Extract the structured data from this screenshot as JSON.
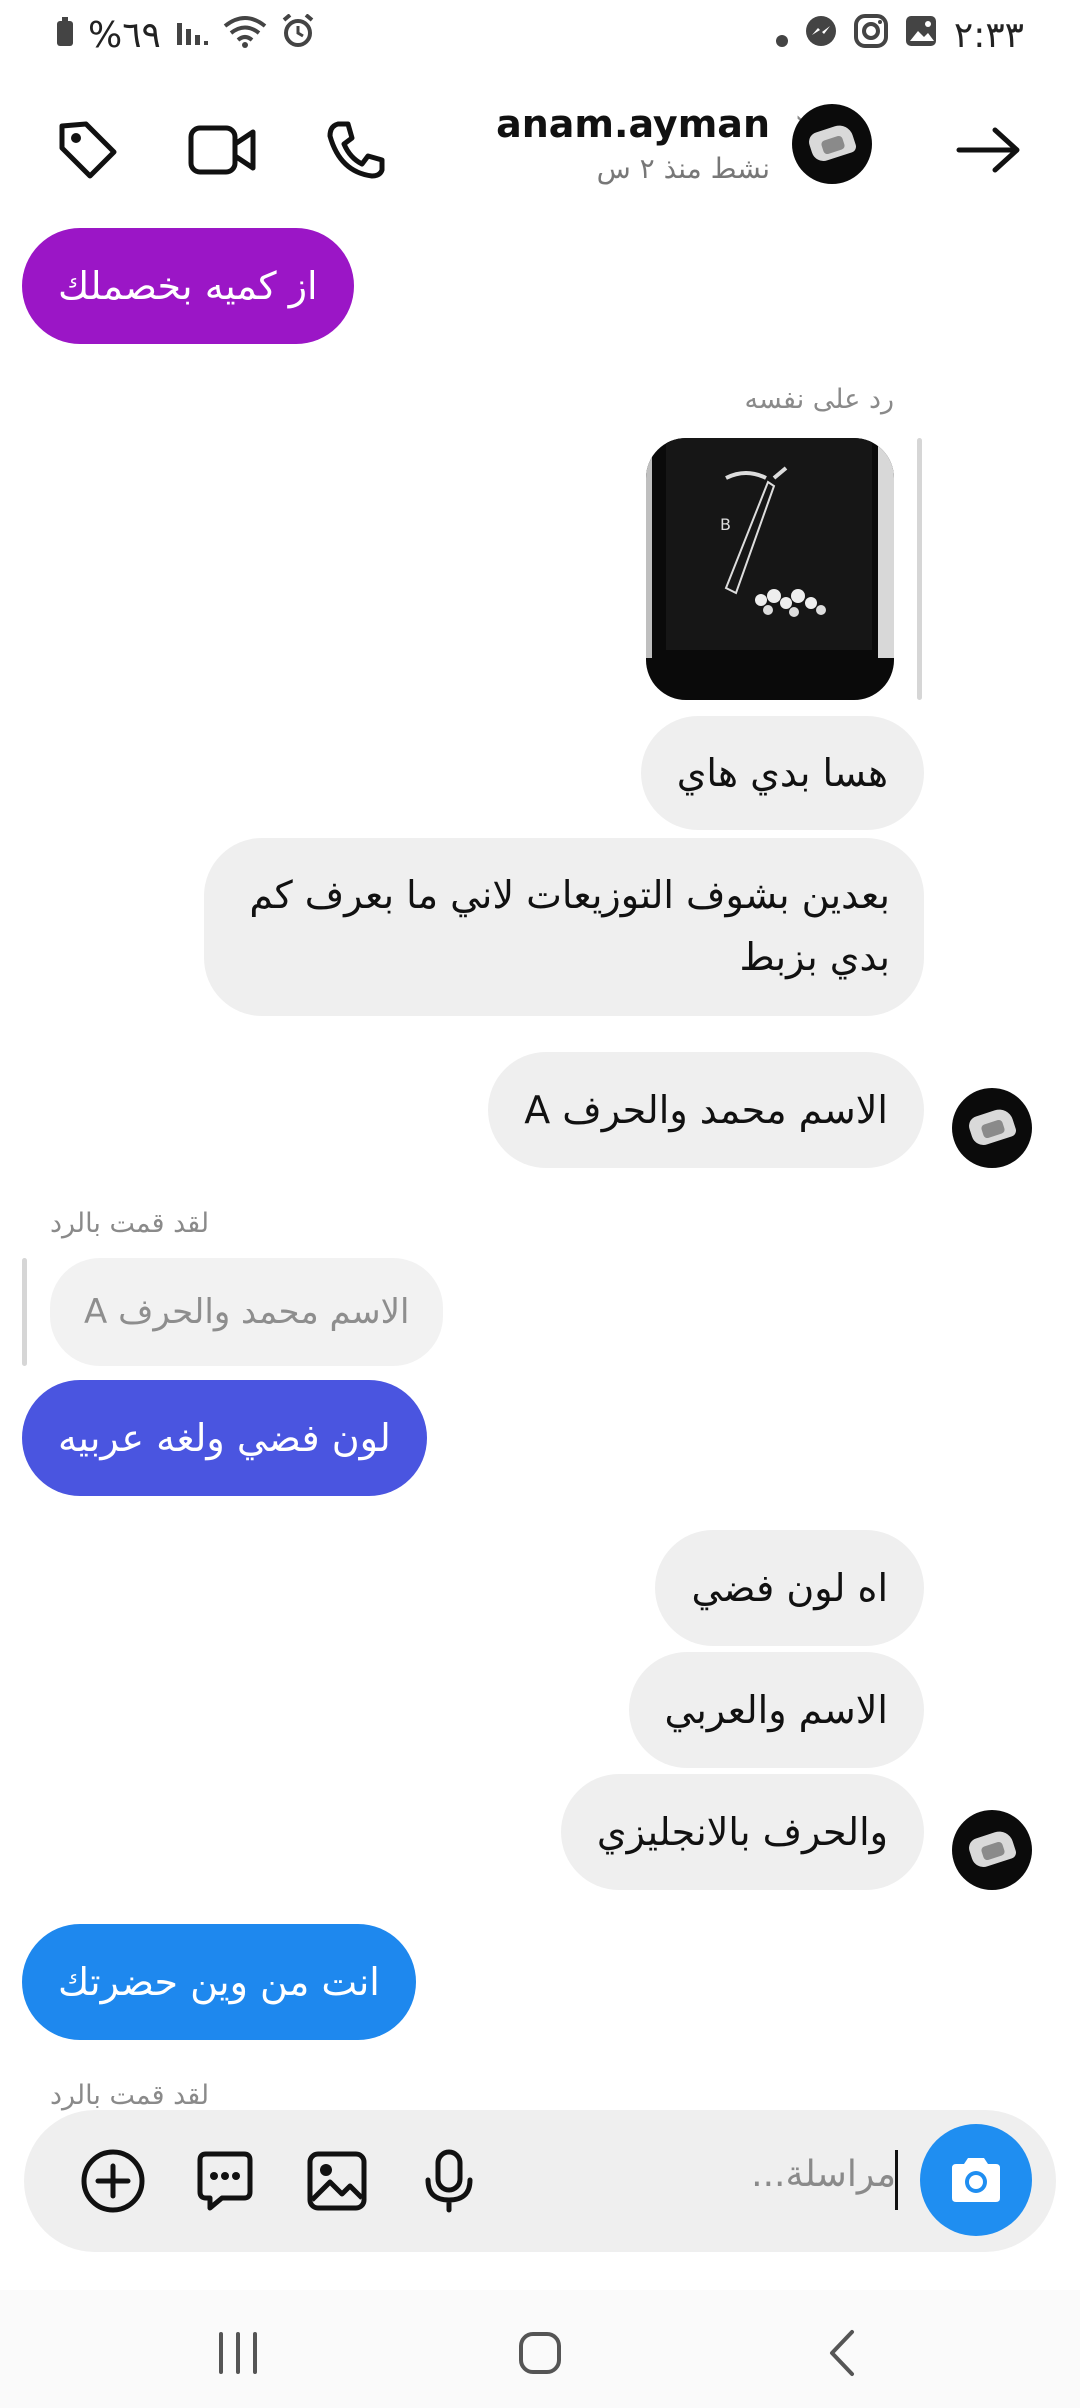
{
  "status_bar": {
    "time": "٢:٣٣",
    "battery": "%٦٩"
  },
  "header": {
    "username": "anam.ayman",
    "active": "نشط منذ ٢ س"
  },
  "messages": [
    {
      "id": "m1",
      "text": "از كميه بخصملك",
      "from": "me"
    },
    {
      "id": "reply_label",
      "text": "رد على نفسه"
    },
    {
      "id": "m2",
      "text": "هسا بدي هاي",
      "from": "them"
    },
    {
      "id": "m3_line1",
      "text": "بعدين بشوف التوزيعات لاني ما بعرف كم",
      "from": "them"
    },
    {
      "id": "m3_line2",
      "text": "بدي بزبط",
      "from": "them"
    },
    {
      "id": "m4",
      "text": "الاسم محمد والحرف A",
      "from": "them"
    },
    {
      "id": "replied_label_1",
      "text": "لقد قمت بالرد"
    },
    {
      "id": "quote_1",
      "text": "الاسم محمد والحرف A"
    },
    {
      "id": "m5",
      "text": "لون فضي ولغه عربيه",
      "from": "me"
    },
    {
      "id": "m6",
      "text": "اه لون فضي",
      "from": "them"
    },
    {
      "id": "m7",
      "text": "الاسم والعربي",
      "from": "them"
    },
    {
      "id": "m8",
      "text": "والحرف بالانجليزي",
      "from": "them"
    },
    {
      "id": "m9",
      "text": "انت من وين حضرتك",
      "from": "me"
    },
    {
      "id": "replied_label_2",
      "text": "لقد قمت بالرد"
    }
  ],
  "composer": {
    "placeholder": "مراسلة..."
  },
  "colors": {
    "purple_bubble": "#9b16c6",
    "indigo_bubble": "#4a55e0",
    "blue_bubble": "#1e88ee",
    "received_bubble": "#efefef",
    "camera_button": "#1f8ef1"
  },
  "icons": {
    "header": [
      "tag-icon",
      "video-call-icon",
      "phone-icon",
      "chevron-right-icon",
      "back-arrow-icon"
    ],
    "composer": [
      "add-icon",
      "sticker-icon",
      "gallery-icon",
      "microphone-icon",
      "camera-icon"
    ],
    "nav": [
      "recent-apps-icon",
      "home-icon",
      "back-icon"
    ]
  }
}
